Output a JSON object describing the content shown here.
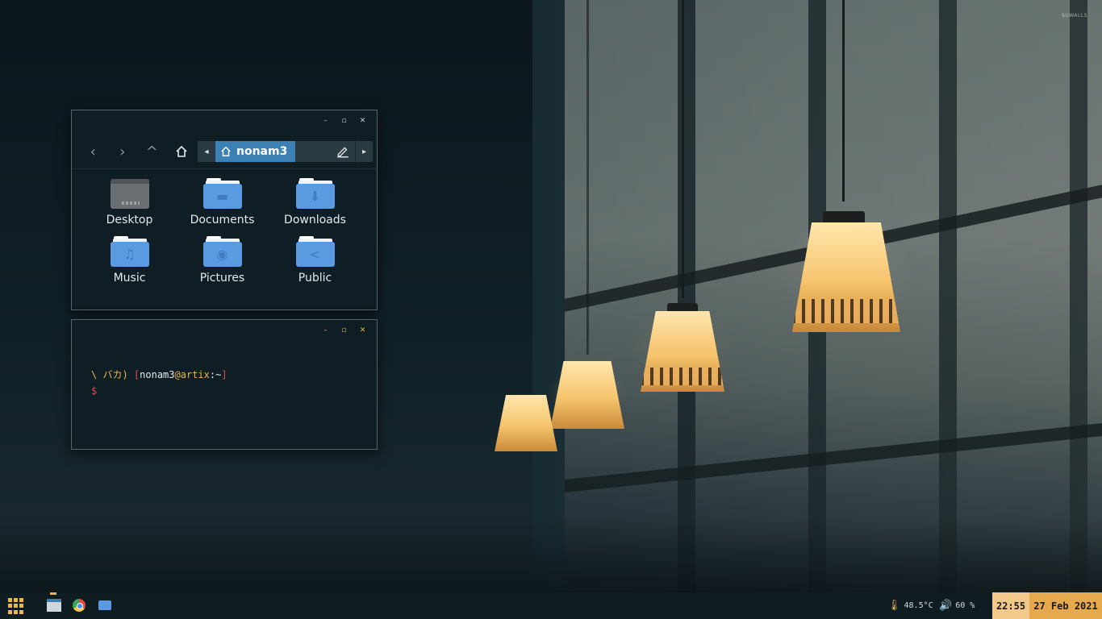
{
  "wallpaper": {
    "watermark": "SUWALLS"
  },
  "file_manager": {
    "controls": {
      "minimize": "–",
      "maximize": "▫",
      "close": "✕"
    },
    "nav": {
      "back": "‹",
      "forward": "›",
      "up": "^"
    },
    "path": {
      "current": "nonam3",
      "left_arrow": "◂",
      "right_arrow": "▸"
    },
    "items": [
      {
        "label": "Desktop",
        "icon": "desktop-folder-icon"
      },
      {
        "label": "Documents",
        "icon": "document-folder-icon",
        "glyph": "▬"
      },
      {
        "label": "Downloads",
        "icon": "download-folder-icon",
        "glyph": "⬇"
      },
      {
        "label": "Music",
        "icon": "music-folder-icon",
        "glyph": "♫"
      },
      {
        "label": "Pictures",
        "icon": "pictures-folder-icon",
        "glyph": "◉"
      },
      {
        "label": "Public",
        "icon": "share-folder-icon",
        "glyph": "<"
      }
    ]
  },
  "terminal": {
    "controls": {
      "minimize": "–",
      "maximize": "▫",
      "close": "✕"
    },
    "prompt_prefix": "\\ バカ)",
    "open_bracket": "[",
    "user": "nonam3",
    "at": "@",
    "host": "artix",
    "path": ":~",
    "close_bracket": "]",
    "symbol": "$"
  },
  "taskbar": {
    "temperature": "48.5°C",
    "volume": "60 %",
    "time": "22:55",
    "date": "27 Feb 2021"
  },
  "colors": {
    "accent": "#e9b64e",
    "folder_blue": "#5a9ae0",
    "pathbar_active": "#3c80b4",
    "prompt_red": "#e04a50"
  }
}
